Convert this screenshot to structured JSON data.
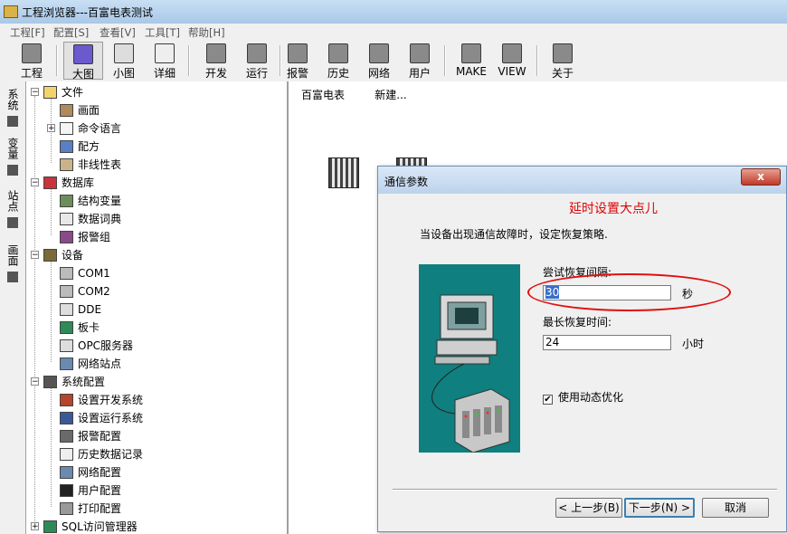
{
  "window": {
    "title": "工程浏览器---百富电表测试"
  },
  "menu": [
    "工程[F]",
    "配置[S]",
    "查看[V]",
    "工具[T]",
    "帮助[H]"
  ],
  "toolbar": [
    {
      "label": "工程",
      "icon": "project-icon"
    },
    {
      "label": "大图",
      "icon": "large-icons-icon",
      "active": true
    },
    {
      "label": "小图",
      "icon": "small-icons-icon"
    },
    {
      "label": "详细",
      "icon": "details-icon"
    },
    {
      "label": "开发",
      "icon": "develop-icon"
    },
    {
      "label": "运行",
      "icon": "run-icon"
    },
    {
      "label": "报警",
      "icon": "alarm-icon"
    },
    {
      "label": "历史",
      "icon": "history-icon"
    },
    {
      "label": "网络",
      "icon": "network-icon"
    },
    {
      "label": "用户",
      "icon": "user-key-icon"
    },
    {
      "label": "MAKE",
      "icon": "make-icon"
    },
    {
      "label": "VIEW",
      "icon": "view-icon"
    },
    {
      "label": "关于",
      "icon": "about-icon"
    }
  ],
  "vtabs": [
    {
      "label": "系统",
      "icon": "system-tab-icon"
    },
    {
      "label": "变量",
      "icon": "variable-tab-icon"
    },
    {
      "label": "站点",
      "icon": "station-tab-icon"
    },
    {
      "label": "画面",
      "icon": "screen-tab-icon"
    }
  ],
  "tree": [
    {
      "label": "文件",
      "level": 0,
      "exp": "−"
    },
    {
      "label": "画面",
      "level": 1
    },
    {
      "label": "命令语言",
      "level": 1,
      "exp": "+"
    },
    {
      "label": "配方",
      "level": 1
    },
    {
      "label": "非线性表",
      "level": 1
    },
    {
      "label": "数据库",
      "level": 0,
      "exp": "−"
    },
    {
      "label": "结构变量",
      "level": 1
    },
    {
      "label": "数据词典",
      "level": 1
    },
    {
      "label": "报警组",
      "level": 1
    },
    {
      "label": "设备",
      "level": 0,
      "exp": "−"
    },
    {
      "label": "COM1",
      "level": 1
    },
    {
      "label": "COM2",
      "level": 1
    },
    {
      "label": "DDE",
      "level": 1
    },
    {
      "label": "板卡",
      "level": 1
    },
    {
      "label": "OPC服务器",
      "level": 1
    },
    {
      "label": "网络站点",
      "level": 1
    },
    {
      "label": "系统配置",
      "level": 0,
      "exp": "−"
    },
    {
      "label": "设置开发系统",
      "level": 1
    },
    {
      "label": "设置运行系统",
      "level": 1
    },
    {
      "label": "报警配置",
      "level": 1
    },
    {
      "label": "历史数据记录",
      "level": 1
    },
    {
      "label": "网络配置",
      "level": 1
    },
    {
      "label": "用户配置",
      "level": 1
    },
    {
      "label": "打印配置",
      "level": 1
    },
    {
      "label": "SQL访问管理器",
      "level": 0,
      "exp": "+"
    }
  ],
  "content_items": [
    "百富电表",
    "新建..."
  ],
  "dialog": {
    "title": "通信参数",
    "close": "x",
    "annotation": "延时设置大点儿",
    "intro": "当设备出现通信故障时，设定恢复策略.",
    "retry_label": "尝试恢复间隔:",
    "retry_value": "30",
    "retry_unit": "秒",
    "max_label": "最长恢复时间:",
    "max_value": "24",
    "max_unit": "小时",
    "checkbox_label": "使用动态优化",
    "checkbox_checked": true,
    "back": "< 上一步(B)",
    "next": "下一步(N) >",
    "cancel": "取消"
  }
}
